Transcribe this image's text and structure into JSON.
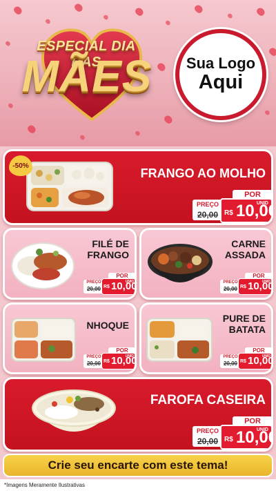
{
  "header": {
    "title_top": "ESPECIAL DIA DAS",
    "title_main": "MÃES",
    "logo_line1": "Sua Logo",
    "logo_line2": "Aqui"
  },
  "price_labels": {
    "por": "POR",
    "preco": "PREÇO",
    "currency": "R$",
    "unit": "UNID"
  },
  "products": [
    {
      "name": "FRANGO AO MOLHO",
      "discount": "-50%",
      "old_price": "20,00",
      "new_price": "10,00"
    },
    {
      "name": "FILÉ DE FRANGO",
      "old_price": "20,00",
      "new_price": "10,00"
    },
    {
      "name": "CARNE ASSADA",
      "old_price": "20,00",
      "new_price": "10,00"
    },
    {
      "name": "NHOQUE",
      "old_price": "20,00",
      "new_price": "10,00"
    },
    {
      "name": "PURE DE BATATA",
      "old_price": "20,00",
      "new_price": "10,00"
    },
    {
      "name": "FAROFA CASEIRA",
      "old_price": "20,00",
      "new_price": "10,00"
    }
  ],
  "cta": "Crie seu encarte com este tema!",
  "disclaimer": "*Imagens Meramente Ilustrativas",
  "colors": {
    "red": "#d81b2c",
    "pink": "#f9c8d4",
    "gold": "#f7d34a",
    "background": "#f3c9cf"
  }
}
